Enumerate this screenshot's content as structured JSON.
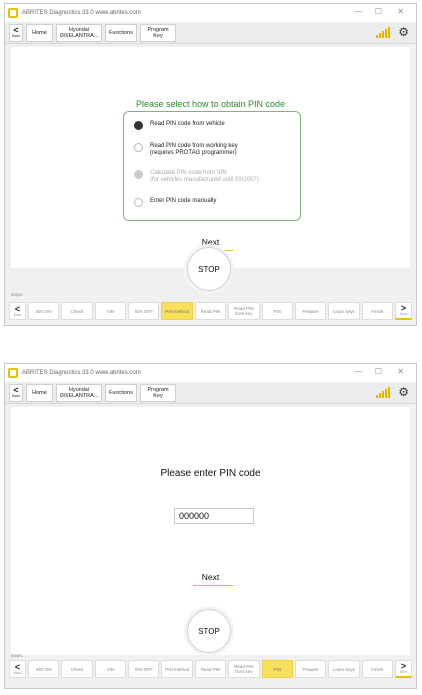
{
  "titlebar": {
    "title": "ABRITES Diagnostics 33.0   www.abrites.com",
    "minimize": "—",
    "maximize": "☐",
    "close": "✕"
  },
  "navbar": {
    "back_label": "Back",
    "home": "Home",
    "vehicle": "Hyundai\ni30/ELANTRA...",
    "functions": "Functions",
    "program_key": "Program\nKey",
    "signal_icon": "signal-bars-icon",
    "settings_icon": "gear-icon"
  },
  "screen1": {
    "prompt": "Please select how to obtain PIN code",
    "options": [
      {
        "label": "Read PIN code from vehicle",
        "state": "selected"
      },
      {
        "label": "Read PIN code from working key\n(requires PROTAG programmer)",
        "state": "normal"
      },
      {
        "label": "Calculate PIN code from VIN\n(for vehicles manufactured until 09/2007)",
        "state": "disabled"
      },
      {
        "label": "Enter PIN code manually",
        "state": "normal"
      }
    ],
    "next": "Next",
    "stop": "STOP",
    "active_step": "PIN method"
  },
  "screen2": {
    "heading": "Please enter PIN code",
    "pin_value": "000000",
    "next": "Next",
    "stop": "STOP",
    "active_step": "PIN"
  },
  "steps": {
    "label": "steps:",
    "back_label": "Back",
    "next_label": "Next",
    "items": [
      "IGN ON",
      "Check",
      "VIN",
      "IGN OFF",
      "PIN method",
      "Read PIN",
      "Read PIN\nfrom key",
      "PIN",
      "Prepare",
      "Learn keys",
      "Finish"
    ]
  },
  "colors": {
    "accent": "#e4c200",
    "active_step": "#f7e05a",
    "prompt_green": "#2e8b2e"
  }
}
